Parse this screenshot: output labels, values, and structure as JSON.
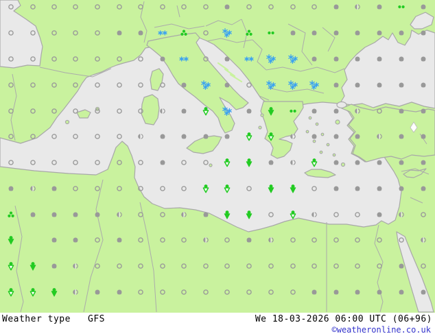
{
  "map": {
    "title": "Weather type map, Mediterranean / Southern Europe",
    "colors": {
      "land": "#c9f29e",
      "sea": "#e9e9e9",
      "coast": "#a8a8a8",
      "symbol_gray": "#999999",
      "symbol_green": "#22cb22",
      "symbol_blue": "#38a1f2",
      "lake": "#ffffff"
    },
    "legend": {
      "o": "clear (open circle)",
      "p": "partly cloudy (half-filled circle)",
      "c": "cloudy (filled gray)",
      "r2": "light rain (two green dots)",
      "r3": "rain (three green dots)",
      "sl": "light rain shower (green dot + open triangle)",
      "sh": "rain shower (green dot + filled triangle)",
      "sn2": "light snow (two blue flakes)",
      "sn3": "snow (blue flake cluster)",
      "x": "none"
    },
    "grid": {
      "cols_x": [
        16,
        48,
        79,
        110,
        142,
        174,
        205,
        237,
        268,
        300,
        331,
        363,
        395,
        427,
        458,
        490,
        521,
        553,
        585,
        617
      ],
      "rows_y": [
        10,
        48,
        86,
        124,
        162,
        199,
        237,
        275,
        313,
        350,
        388,
        426
      ],
      "cells": [
        "o o o o o o o o o o c o o o o c p c r2 c",
        "o o o o o c c sn2 r3 o sn3 r3 r2 c c c c c c c",
        "o o o o o o o c sn2 o c sn2 sn3 sn3 c c c c c c",
        "o o o o o o o o c sn3 c o sn3 sn3 sn3 c c c c c",
        "o o o o o o o p c sl sn3 c sh r2 c c p o c c",
        "o o o o o o p c c c c sl sl p c c c p c c",
        "o o o o o o o c o o sl sh c p sl c c c c c",
        "c p c o o o o o o sl sl o sh sh o c c c c c",
        "r3 c c c c p o o p c sh sh o sl p o o c p o",
        "sh x c c o c o o o p o c p o o o o o o p",
        "sl sh c p o o o o o o o o o o o o o o c o",
        "sl sl sh p c c o o o o o o o o c c c c c c"
      ]
    }
  },
  "footer": {
    "left_label": "Weather type",
    "model": "GFS",
    "datetime": "We 18-03-2026 06:00 UTC (06+96)",
    "copyright": "©weatheronline.co.uk"
  }
}
